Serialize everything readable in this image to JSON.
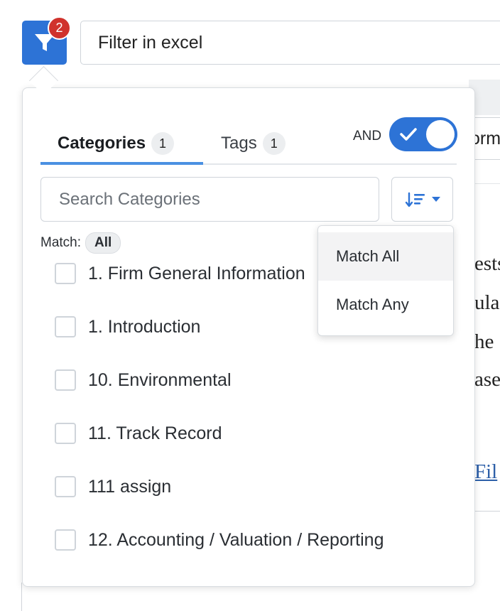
{
  "toolbar": {
    "filter_icon": "filter-funnel-icon",
    "badge_count": "2",
    "search_value": "Filter in excel"
  },
  "background": {
    "field_text": "orm",
    "lines": [
      "ests",
      "ula",
      "he",
      "ase"
    ],
    "link_text": "Fil"
  },
  "popover": {
    "tabs": [
      {
        "label": "Categories",
        "count": "1",
        "active": true
      },
      {
        "label": "Tags",
        "count": "1",
        "active": false
      }
    ],
    "operator_label": "AND",
    "operator_toggle_on": true,
    "search_placeholder": "Search Categories",
    "sort_icon": "sort-descending-icon",
    "match_label": "Match:",
    "match_value": "All",
    "categories": [
      "1. Firm General Information",
      "1. Introduction",
      "10. Environmental",
      "11. Track Record",
      "111 assign",
      "12. Accounting / Valuation / Reporting"
    ]
  },
  "match_menu": {
    "options": [
      "Match All",
      "Match Any"
    ],
    "selected": "Match All"
  },
  "colors": {
    "primary": "#2d73d6",
    "badge": "#d0322c",
    "tab_underline": "#4a90e2"
  }
}
